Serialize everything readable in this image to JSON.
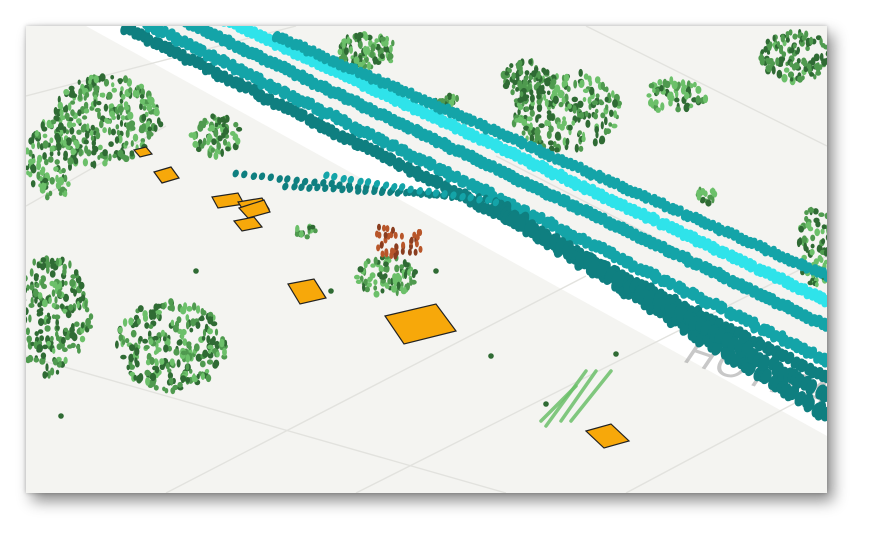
{
  "map": {
    "street_label": "HOTHA",
    "colors": {
      "background": "#f4f4f1",
      "road_stripe": "#ffffff",
      "teal_dark": "#0f7f80",
      "teal_mid": "#14a4a8",
      "cyan_bright": "#2fe3ea",
      "tree_dark": "#2f6b34",
      "tree_mid": "#4f9a4f",
      "tree_light": "#6cc06a",
      "building_fill": "#f7a80a",
      "building_stroke": "#222222",
      "orange_cluster": "#b8562a"
    }
  }
}
